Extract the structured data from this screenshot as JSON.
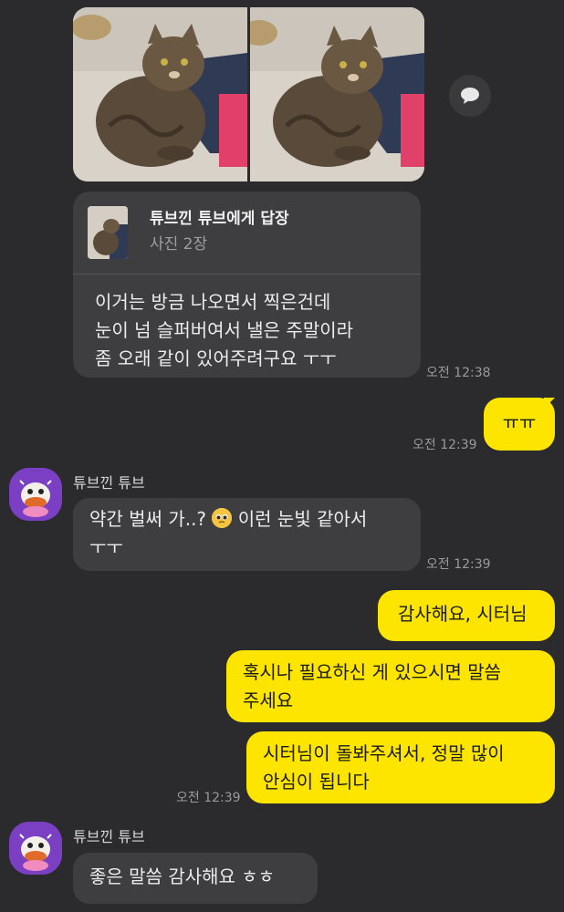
{
  "photos": {
    "count_label": "사진 2장"
  },
  "messages": [
    {
      "id": "reply_msg",
      "reply_title": "튜브낀 튜브에게 답장",
      "reply_sub": "사진 2장",
      "lines": [
        "이거는 방금 나오면서 찍은건데",
        "눈이 넘 슬퍼버여서 낼은 주말이라",
        "좀 오래 같이 있어주려구요 ㅜㅜ"
      ],
      "time": "오전 12:38"
    },
    {
      "id": "my_tt",
      "text": "ㅠㅠ",
      "time": "오전 12:39"
    },
    {
      "id": "their_msg2",
      "sender": "튜브낀 튜브",
      "line1_before": "약간 벌써 가..? ",
      "line1_after": " 이런 눈빛 같아서",
      "line2": "ㅜㅜ",
      "time": "오전 12:39"
    },
    {
      "id": "my_thanks",
      "text": "감사해요, 시터님"
    },
    {
      "id": "my_ask",
      "lines": [
        "혹시나 필요하신 게 있으시면 말씀",
        "주세요"
      ]
    },
    {
      "id": "my_relief",
      "lines": [
        "시터님이 돌봐주셔서, 정말 많이",
        "안심이 됩니다"
      ],
      "time": "오전 12:39"
    },
    {
      "id": "their_msg3",
      "sender": "튜브낀 튜브",
      "text": "좋은 말씀 감사해요 ㅎㅎ"
    }
  ],
  "colors": {
    "background": "#2b2b2d",
    "incoming_bubble": "#3e3e41",
    "outgoing_bubble": "#fee500"
  },
  "icons": {
    "share": "chat-bubble-icon",
    "avatar": "tube-character-avatar"
  }
}
